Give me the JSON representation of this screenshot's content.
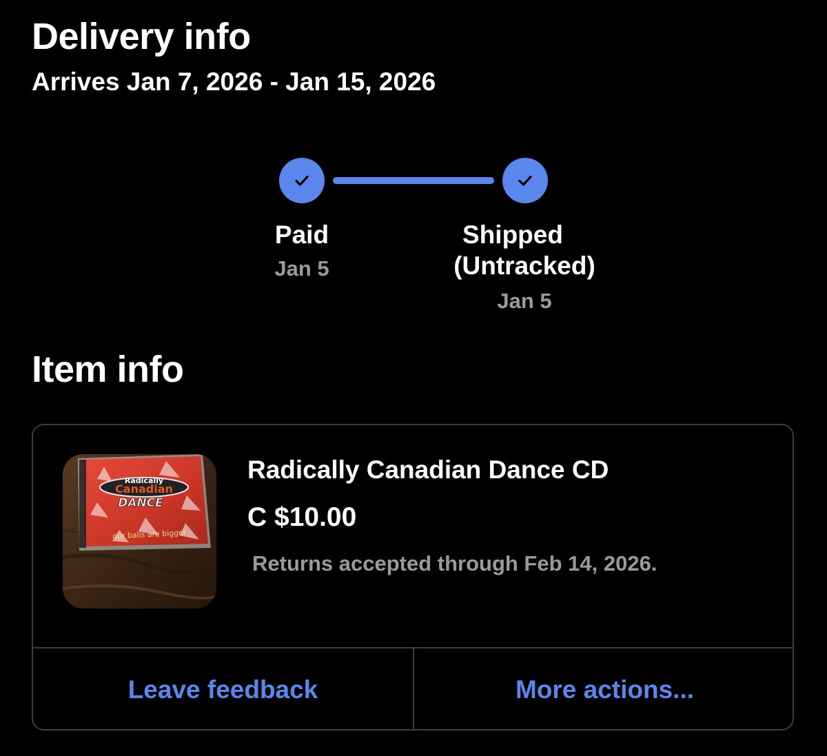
{
  "delivery": {
    "title": "Delivery info",
    "arrival": "Arrives Jan 7, 2026 - Jan 15, 2026"
  },
  "progress": {
    "accent_color": "#5b87ec",
    "steps": [
      {
        "label": "Paid",
        "date": "Jan 5",
        "completed": true,
        "icon": "checkmark-icon"
      },
      {
        "label_line1": "Shipped",
        "label_line2": "(Untracked)",
        "date": "Jan 5",
        "completed": true,
        "icon": "checkmark-icon"
      }
    ]
  },
  "item_info": {
    "title": "Item info",
    "item": {
      "name": "Radically Canadian Dance CD",
      "price": "C $10.00",
      "returns": "Returns accepted through Feb 14, 2026.",
      "thumbnail": {
        "brand_line1": "Radically",
        "brand_line2": "Canadian",
        "brand_line3": "DANCE",
        "tagline": "our balls are bigger"
      }
    },
    "actions": {
      "feedback": "Leave feedback",
      "more": "More actions..."
    }
  }
}
